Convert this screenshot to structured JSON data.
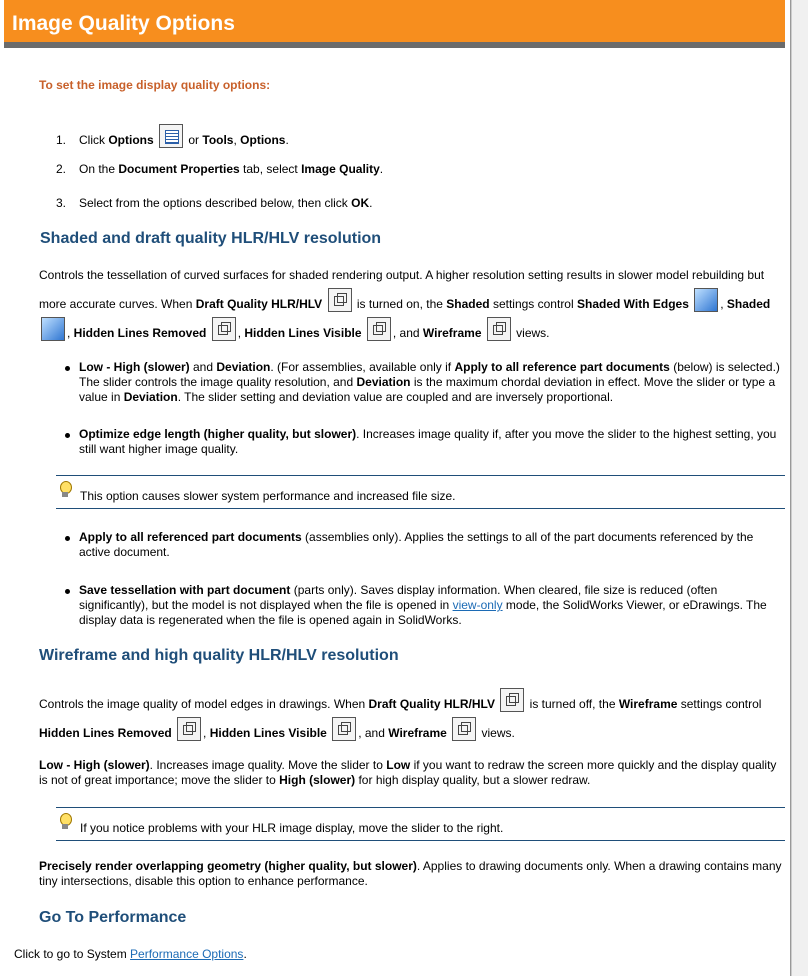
{
  "title": "Image Quality Options",
  "intro": "To set the image display quality options:",
  "steps": [
    {
      "num": "1.",
      "pre": "Click ",
      "b1": "Options",
      "mid": " or ",
      "b2": "Tools",
      "sep": ", ",
      "b3": "Options",
      "end": "."
    },
    {
      "num": "2.",
      "pre": "On the ",
      "b1": "Document Properties",
      "mid": " tab, select ",
      "b2": "Image Quality",
      "end": "."
    },
    {
      "num": "3.",
      "pre": "Select from the options described below, then click ",
      "b1": "OK",
      "end": "."
    }
  ],
  "section1": {
    "heading": "Shaded and draft quality HLR/HLV resolution",
    "p1": "Controls the tessellation of curved surfaces for shaded rendering output. A higher resolution setting results in slower model rebuilding but more accurate curves. When ",
    "b_draft": "Draft Quality HLR/HLV",
    "p2": " is turned on, the ",
    "b_shaded": "Shaded",
    "p3": " settings control ",
    "b_swe": "Shaded With Edges",
    "b_sh": "Shaded",
    "b_hlr": "Hidden Lines Removed",
    "b_hlv": "Hidden Lines Visible",
    "and": ", and ",
    "b_wf": "Wireframe",
    "views": " views.",
    "bullet1_b": "Low - High (slower)",
    "bullet1_a": " and ",
    "bullet1_b2": "Deviation",
    "bullet1_c": ". (For assemblies, available only if ",
    "bullet1_b3": "Apply to all reference part documents",
    "bullet1_d": " (below) is selected.) The slider controls the image quality resolution, and ",
    "bullet1_b4": "Deviation",
    "bullet1_e": " is the maximum chordal deviation in effect. Move the slider or type a value in ",
    "bullet1_b5": "Deviation",
    "bullet1_f": ". The slider setting and deviation value are coupled and are inversely proportional.",
    "bullet2_b": "Optimize edge length (higher quality, but slower)",
    "bullet2_t": ". Increases image quality if, after you move the slider to the highest setting, you still want higher image quality.",
    "note": "This option causes slower system performance and increased file size.",
    "bullet3_b": "Apply to all referenced part documents",
    "bullet3_t": " (assemblies only). Applies the settings to all of the part documents referenced by the active document.",
    "bullet4_b": "Save tessellation with part document",
    "bullet4_t1": " (parts only). Saves display information. When cleared, file size is reduced (often significantly), but the model is not displayed when the file is opened in ",
    "bullet4_link": "view-only",
    "bullet4_t2": " mode, the SolidWorks Viewer, or eDrawings. The display data is regenerated when the file is opened again in SolidWorks."
  },
  "section2": {
    "heading": "Wireframe and high quality HLR/HLV resolution",
    "p1": "Controls the image quality of model edges in drawings. When ",
    "b_draft": "Draft Quality HLR/HLV",
    "p2": " is turned off, the ",
    "b_wf": "Wireframe",
    "p3": " settings control ",
    "b_hlr": "Hidden Lines Removed",
    "b_hlv": "Hidden Lines Visible",
    "and": ", and ",
    "b_wf2": "Wireframe",
    "views": " views.",
    "low_b": "Low - High (slower)",
    "low_t1": ". Increases image quality. Move the slider to ",
    "low_b2": "Low",
    "low_t2": " if you want to redraw the screen more quickly and the display quality is not of great importance; move the slider to ",
    "low_b3": "High (slower)",
    "low_t3": " for high display quality, but a slower redraw.",
    "note": "If you notice problems with your HLR image display, move the slider to the right.",
    "prec_b": "Precisely render overlapping geometry (higher quality, but slower)",
    "prec_t": ". Applies to drawing documents only. When a drawing contains many tiny intersections, disable this option to enhance performance."
  },
  "section3": {
    "heading": "Go To Performance",
    "text": "Click to go to System ",
    "link": "Performance Options",
    "end": "."
  }
}
